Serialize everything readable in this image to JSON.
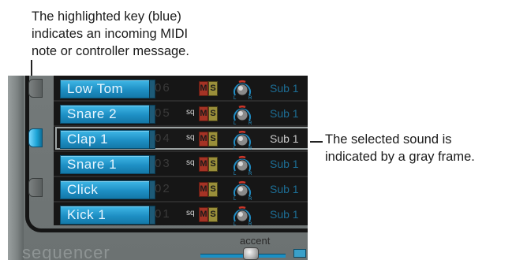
{
  "callouts": {
    "highlight_key": "The highlighted key (blue)\nindicates an incoming MIDI\nnote or controller message.",
    "selected_sound": "The selected sound is\nindicated by a gray frame."
  },
  "panel": {
    "sequencer_label": "sequencer",
    "accent_label": "accent",
    "rows": [
      {
        "name": "Low Tom",
        "number": "06",
        "sq": "",
        "mute": "M",
        "solo": "S",
        "output": "Sub 1"
      },
      {
        "name": "Snare 2",
        "number": "05",
        "sq": "sq",
        "mute": "M",
        "solo": "S",
        "output": "Sub 1"
      },
      {
        "name": "Clap 1",
        "number": "04",
        "sq": "sq",
        "mute": "M",
        "solo": "S",
        "output": "Sub 1"
      },
      {
        "name": "Snare 1",
        "number": "03",
        "sq": "sq",
        "mute": "M",
        "solo": "S",
        "output": "Sub 1"
      },
      {
        "name": "Click",
        "number": "02",
        "sq": "",
        "mute": "M",
        "solo": "S",
        "output": "Sub 1"
      },
      {
        "name": "Kick 1",
        "number": "01",
        "sq": "sq",
        "mute": "M",
        "solo": "S",
        "output": "Sub 1"
      }
    ],
    "selected_row": "Clap 1",
    "highlighted_key": "Clap 1",
    "accent_level": 0.6
  },
  "colors": {
    "name_button": "#1e8fc4",
    "highlight_key": "#1ca3d6",
    "mute": "#a53325",
    "solo": "#9a8f3a",
    "selected_frame": "#9ea4a4"
  }
}
